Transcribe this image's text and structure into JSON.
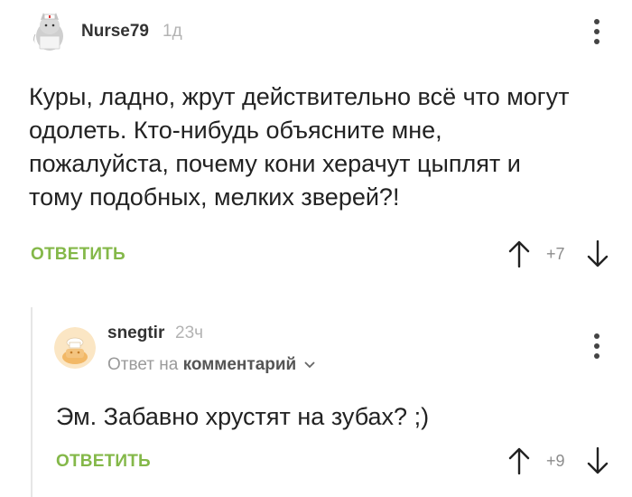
{
  "comment": {
    "user": "Nurse79",
    "time": "1д",
    "text": "Куры, ладно, жрут действительно всё что могут одолеть. Кто-нибудь объясните мне, пожалуйста, почему кони херачут цыплят и тому подобных, мелких зверей?!",
    "reply_label": "ОТВЕТИТЬ",
    "rating": "+7"
  },
  "reply": {
    "user": "snegtir",
    "time": "23ч",
    "reply_prefix": "Ответ на",
    "reply_target": "комментарий",
    "text": "Эм. Забавно хрустят на зубах? ;)",
    "reply_label": "ОТВЕТИТЬ",
    "rating": "+9"
  },
  "colors": {
    "accent": "#84b849",
    "muted": "#b3b3b3",
    "text": "#222222"
  }
}
